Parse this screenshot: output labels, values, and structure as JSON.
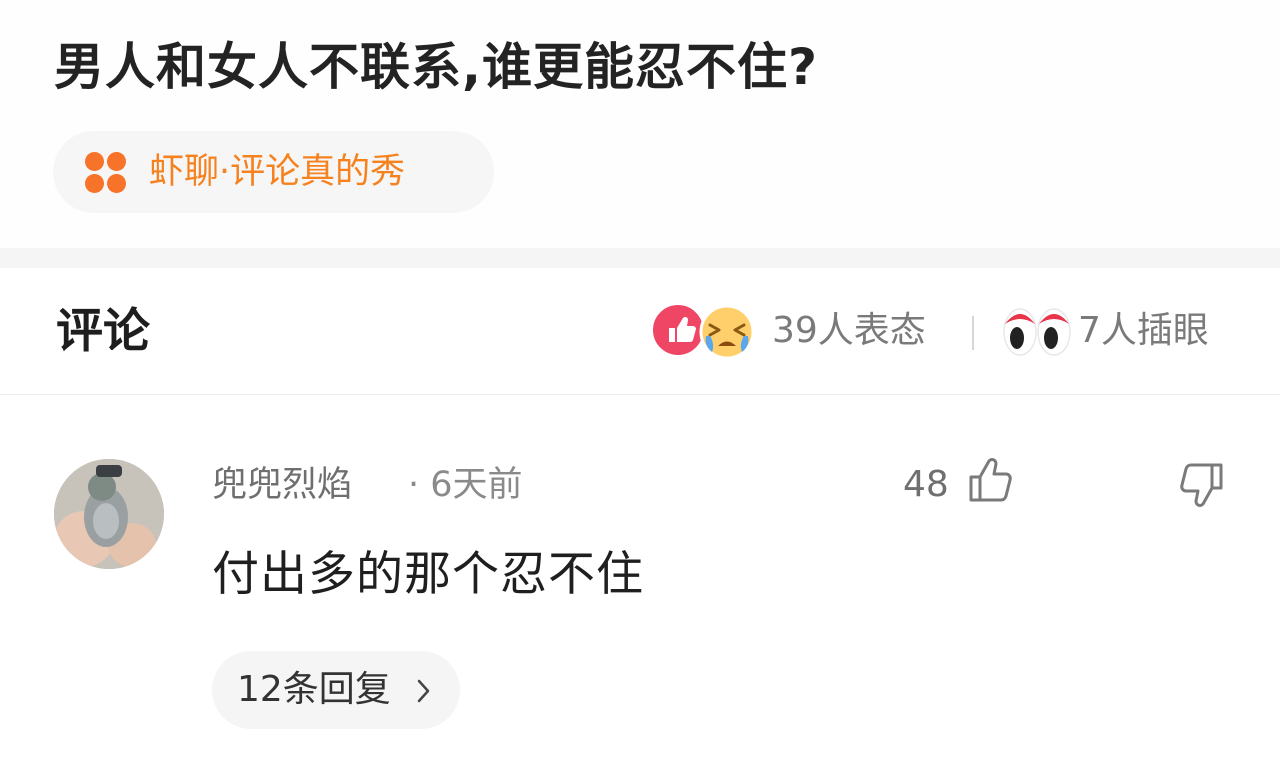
{
  "question": {
    "title": "男人和女人不联系,谁更能忍不住?",
    "topic": {
      "label": "虾聊·评论真的秀",
      "icon": "four-dots-icon",
      "color": "#f5821f"
    }
  },
  "comments_header": {
    "heading": "评论",
    "reactions": {
      "icons": [
        "thumbs-up-badge-icon",
        "crying-face-icon"
      ],
      "count_label": "39人表态"
    },
    "watch": {
      "icon": "eyes-icon",
      "count_label": "7人插眼"
    }
  },
  "comment": {
    "author": "兜兜烈焰",
    "time": "· 6天前",
    "likes": "48",
    "body": "付出多的那个忍不住",
    "replies_label": "12条回复"
  },
  "colors": {
    "accent": "#f5821f",
    "like_badge": "#f04666",
    "muted_text": "#7a7a7a"
  }
}
